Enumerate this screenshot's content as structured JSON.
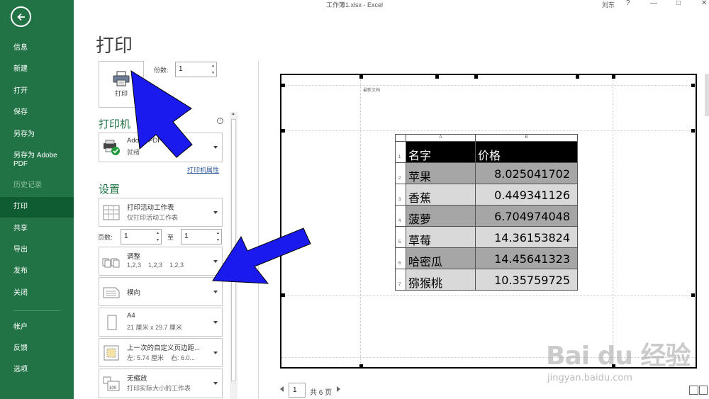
{
  "window": {
    "title": "工作簿1.xlsx  -  Excel",
    "user": "刘东",
    "help": "?",
    "minimize": "—",
    "maximize": "□",
    "close": "✕"
  },
  "sidebar": {
    "items": [
      {
        "label": "信息"
      },
      {
        "label": "新建"
      },
      {
        "label": "打开"
      },
      {
        "label": "保存"
      },
      {
        "label": "另存为"
      },
      {
        "label": "另存为 Adobe PDF"
      },
      {
        "label": "历史记录"
      },
      {
        "label": "打印"
      },
      {
        "label": "共享"
      },
      {
        "label": "导出"
      },
      {
        "label": "发布"
      },
      {
        "label": "关闭"
      },
      {
        "label": "帐户"
      },
      {
        "label": "反馈"
      },
      {
        "label": "选项"
      }
    ],
    "active": "打印"
  },
  "print": {
    "heading": "打印",
    "button_label": "打印",
    "copies_label": "份数:",
    "copies_value": "1"
  },
  "printer": {
    "section_title": "打印机",
    "name": "Adobe PDF",
    "status": "就绪",
    "properties_link": "打印机属性"
  },
  "settings": {
    "section_title": "设置",
    "scope": {
      "line1": "打印活动工作表",
      "line2": "仅打印活动工作表"
    },
    "pages_label": "页数:",
    "pages_from": "1",
    "to_label": "至",
    "pages_to": "1",
    "collate": {
      "line1": "调整",
      "line2": "1,2,3    1,2,3    1,2,3"
    },
    "orientation": {
      "line1": "横向"
    },
    "paper": {
      "line1": "A4",
      "line2": "21 厘米 x 29.7 厘米"
    },
    "margins": {
      "line1": "上一次的自定义页边距...",
      "line2": "左: 5.74 厘米    右: 6.0..."
    },
    "scaling": {
      "line1": "无缩放",
      "line2": "打印实际大小的工作表"
    },
    "scaling_icon_text": "100"
  },
  "preview": {
    "header_text": "最新文档",
    "col_headers": [
      "A",
      "B"
    ],
    "rows": [
      {
        "num": "1",
        "name": "名字",
        "price": "价格",
        "style": "head"
      },
      {
        "num": "2",
        "name": "苹果",
        "price": "8.025041702",
        "style": "dark"
      },
      {
        "num": "3",
        "name": "香蕉",
        "price": "0.449341126",
        "style": "light"
      },
      {
        "num": "4",
        "name": "菠萝",
        "price": "6.704974048",
        "style": "dark"
      },
      {
        "num": "5",
        "name": "草莓",
        "price": "14.36153824",
        "style": "light"
      },
      {
        "num": "6",
        "name": "哈密瓜",
        "price": "14.45641323",
        "style": "dark"
      },
      {
        "num": "7",
        "name": "猕猴桃",
        "price": "10.35759725",
        "style": "light"
      }
    ],
    "page_current": "1",
    "page_total": "共 6 页"
  },
  "watermark": {
    "logo": "Bai du 经验",
    "url": "jingyan.baidu.com"
  },
  "colors": {
    "sidebar_bg": "#217346",
    "sidebar_active": "#0f5c32",
    "accent_green": "#217346",
    "arrow_blue": "#1a1aee"
  },
  "icons": [
    "back-arrow-icon",
    "printer-icon",
    "adobe-pdf-printer-icon",
    "sheet-grid-icon",
    "collate-icon",
    "landscape-page-icon",
    "portrait-page-icon",
    "margins-icon",
    "scaling-icon",
    "info-icon",
    "show-margins-icon",
    "zoom-page-icon"
  ]
}
